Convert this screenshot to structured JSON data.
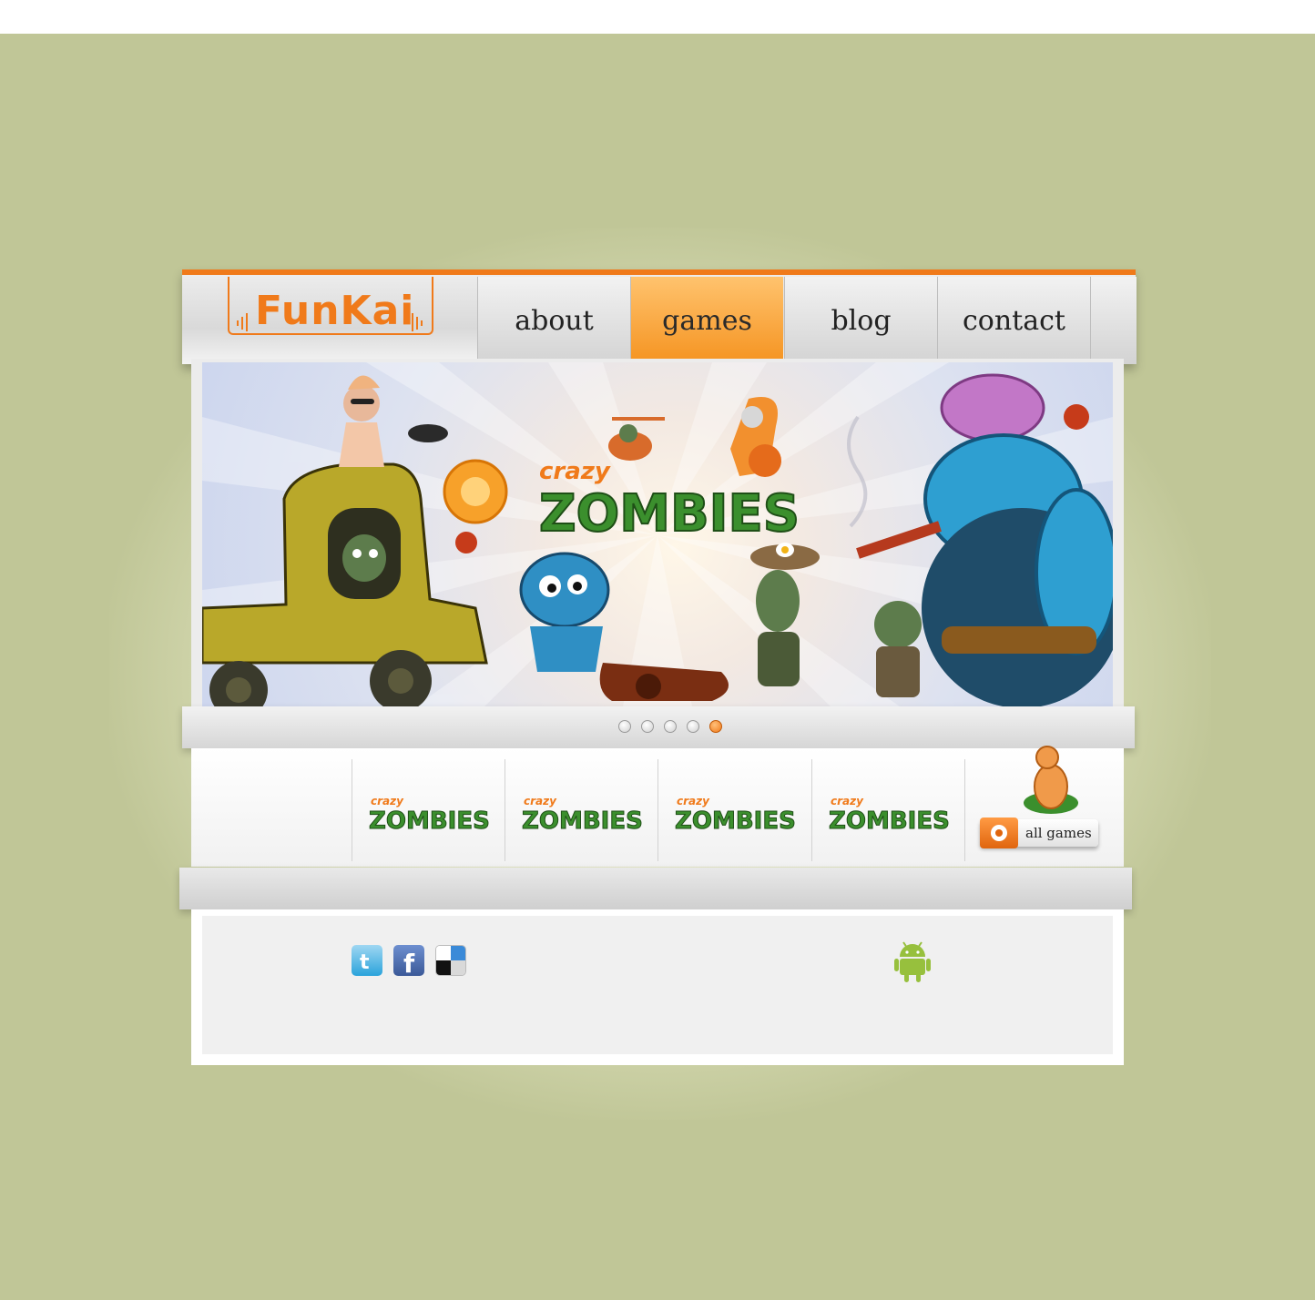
{
  "brand": {
    "logo_text": "FunKai",
    "accent": "#f07a1a"
  },
  "nav": {
    "items": [
      {
        "label": "about",
        "active": false
      },
      {
        "label": "games",
        "active": true
      },
      {
        "label": "blog",
        "active": false
      },
      {
        "label": "contact",
        "active": false
      }
    ]
  },
  "hero": {
    "game_title_small": "crazy",
    "game_title_large": "ZOMBIES",
    "slides": 5,
    "active_slide": 5
  },
  "thumbnails": {
    "items": [
      {
        "small": "crazy",
        "large": "ZOMBIES"
      },
      {
        "small": "crazy",
        "large": "ZOMBIES"
      },
      {
        "small": "crazy",
        "large": "ZOMBIES"
      },
      {
        "small": "crazy",
        "large": "ZOMBIES"
      }
    ],
    "all_games_label": "all games"
  },
  "footer": {
    "social": [
      "twitter-icon",
      "facebook-icon",
      "delicious-icon"
    ],
    "platform": "android-icon"
  },
  "colors": {
    "background": "#c0c697",
    "accent_orange": "#f07a1a",
    "zombie_green": "#3b8f2d",
    "zombie_blue": "#2f8fc4"
  }
}
